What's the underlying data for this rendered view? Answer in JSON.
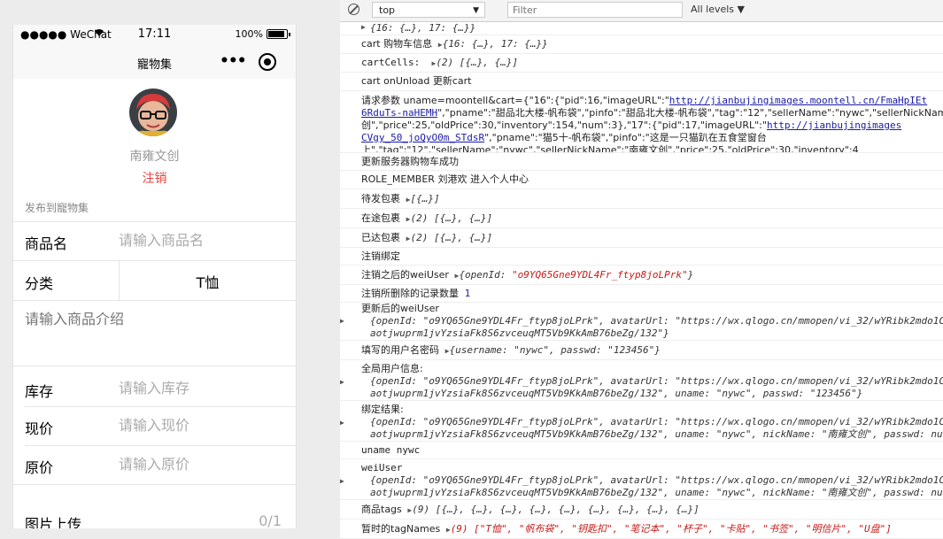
{
  "phone": {
    "status": {
      "carrier": "●●●●● WeChat",
      "time": "17:11",
      "battery": "100%"
    },
    "nav_title": "寵物集",
    "nickname": "南雍文创",
    "logout": "注销",
    "section_label": "发布到寵物集",
    "fields": [
      {
        "label": "商品名",
        "placeholder": "请输入商品名"
      },
      {
        "label": "分类",
        "value": "T恤"
      },
      {
        "placeholder": "请输入商品介绍"
      },
      {
        "label": "库存",
        "placeholder": "请输入库存"
      },
      {
        "label": "现价",
        "placeholder": "请输入现价"
      },
      {
        "label": "原价",
        "placeholder": "请输入原价"
      },
      {
        "label": "图片上传",
        "count": "0/1"
      }
    ]
  },
  "devtools": {
    "context": "top",
    "filter_placeholder": "Filter",
    "levels": "All levels",
    "log": [
      "{16: {…}, 17: {…}}",
      "cart 购物车信息",
      "{16: {…}, 17: {…}}",
      "cartCells:",
      "(2) [{…}, {…}]",
      "cart onUnload 更新cart",
      "请求参数 uname=moontell&cart={\"16\":{\"pid\":16,\"imageURL\":\"",
      "http://jianbujingimages.moontell.cn/FmaHpIEt",
      "6RduTs-naHEMH",
      "\",\"pname\":\"甜品北大楼-帆布袋\",\"pinfo\":\"甜品北大楼-帆布袋\",\"tag\":\"12\",\"sellerName\":\"nywc\",\"sellerNickName\":\"南雍文",
      "创\",\"price\":25,\"oldPrice\":30,\"inventory\":154,\"num\":3},\"17\":{\"pid\":17,\"imageURL\":\"",
      "http://jianbujingimages",
      "CVgy_50_joQyO0m_STdsR",
      "\",\"pname\":\"猫5十-帆布袋\",\"pinfo\":\"这是一只猫趴在五食堂窗台",
      "上\",\"tag\":\"12\",\"sellerName\":\"nywc\",\"sellerNickName\":\"南雍文创\",\"price\":25,\"oldPrice\":30,\"inventory\":4",
      "更新服务器购物车成功",
      "ROLE_MEMBER 刘港欢 进入个人中心",
      "待发包裹",
      "[{…}]",
      "在途包裹",
      "(2) [{…}, {…}]",
      "已达包裹",
      "(2) [{…}, {…}]",
      "注销绑定",
      "注销之后的weiUser",
      "{openId: ",
      "\"o9YQ65Gne9YDL4Fr_ftyp8joLPrk\"",
      "}",
      "注销所删除的记录数量",
      "1",
      "更新后的weiUser",
      "{openId: \"o9YQ65Gne9YDL4Fr_ftyp8joLPrk\", avatarUrl: \"https://wx.qlogo.cn/mmopen/vi_32/wYRibk2mdo1C",
      "aotjwuprm1jvYzsiaFk8S6zvceuqMT5Vb9KkAmB76beZg/132\"}",
      "填写的用户名密码",
      "{username: \"nywc\", passwd: \"123456\"}",
      "全局用户信息:",
      "{openId: \"o9YQ65Gne9YDL4Fr_ftyp8joLPrk\", avatarUrl: \"https://wx.qlogo.cn/mmopen/vi_32/wYRibk2mdo1C",
      "aotjwuprm1jvYzsiaFk8S6zvceuqMT5Vb9KkAmB76beZg/132\", uname: \"nywc\", passwd: \"123456\"}",
      "绑定结果:",
      "{openId: \"o9YQ65Gne9YDL4Fr_ftyp8joLPrk\", avatarUrl: \"https://wx.qlogo.cn/mmopen/vi_32/wYRibk2mdo1C",
      "aotjwuprm1jvYzsiaFk8S6zvceuqMT5Vb9KkAmB76beZg/132\", uname: \"nywc\", nickName: \"南雍文创\", passwd: nu",
      "uname nywc",
      "weiUser",
      "{openId: \"o9YQ65Gne9YDL4Fr_ftyp8joLPrk\", avatarUrl: \"https://wx.qlogo.cn/mmopen/vi_32/wYRibk2mdo1C",
      "aotjwuprm1jvYzsiaFk8S6zvceuqMT5Vb9KkAmB76beZg/132\", uname: \"nywc\", nickName: \"南雍文创\", passwd: nu",
      "商品tags",
      "(9) [{…}, {…}, {…}, {…}, {…}, {…}, {…}, {…}, {…}]",
      "暂时的tagNames",
      "(9) [\"T恤\", \"帆布袋\", \"钥匙扣\", \"笔记本\", \"杯子\", \"卡贴\", \"书签\", \"明信片\", \"U盘\"]"
    ]
  }
}
